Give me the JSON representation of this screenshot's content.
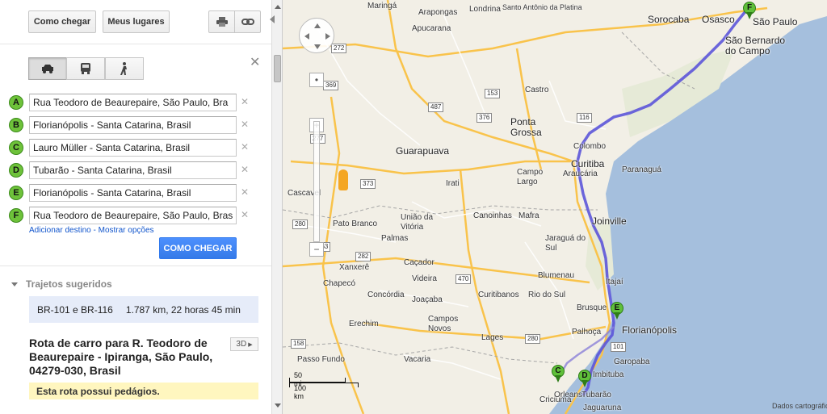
{
  "toolbar": {
    "directions_label": "Como chegar",
    "places_label": "Meus lugares",
    "print_icon": "printer-icon",
    "link_icon": "link-icon"
  },
  "travel_modes": {
    "car_icon": "car-icon",
    "transit_icon": "bus-icon",
    "walk_icon": "walking-icon",
    "selected": "car"
  },
  "waypoints": [
    {
      "letter": "A",
      "value": "Rua Teodoro de Beaurepaire, São Paulo, Bra"
    },
    {
      "letter": "B",
      "value": "Florianópolis - Santa Catarina, Brasil"
    },
    {
      "letter": "C",
      "value": "Lauro Müller - Santa Catarina, Brasil"
    },
    {
      "letter": "D",
      "value": "Tubarão - Santa Catarina, Brasil"
    },
    {
      "letter": "E",
      "value": "Florianópolis - Santa Catarina, Brasil"
    },
    {
      "letter": "F",
      "value": "Rua Teodoro de Beaurepaire, São Paulo, Bras"
    }
  ],
  "links": {
    "add_destination": "Adicionar destino",
    "separator": " - ",
    "show_options": "Mostrar opções"
  },
  "go_button": "COMO CHEGAR",
  "suggested": {
    "heading": "Trajetos sugeridos",
    "route_name": "BR-101 e BR-116",
    "route_summary": "1.787 km, 22 horas 45 min"
  },
  "route_title": "Rota de carro para R. Teodoro de Beaurepaire - Ipiranga, São Paulo, 04279-030, Brasil",
  "btn_3d": "3D",
  "toll_notice": "Esta rota possui pedágios.",
  "map": {
    "cities": [
      {
        "name": "Maringá"
      },
      {
        "name": "Arapongas"
      },
      {
        "name": "Londrina"
      },
      {
        "name": "Apucarana"
      },
      {
        "name": "Santo Antônio da Platina"
      },
      {
        "name": "Sorocaba"
      },
      {
        "name": "Osasco"
      },
      {
        "name": "São Paulo"
      },
      {
        "name": "São Bernardo do Campo"
      },
      {
        "name": "Ponta Grossa"
      },
      {
        "name": "Guarapuava"
      },
      {
        "name": "Colombo"
      },
      {
        "name": "Curitiba"
      },
      {
        "name": "Araucária"
      },
      {
        "name": "Campo Largo"
      },
      {
        "name": "Paranaguá"
      },
      {
        "name": "Joinville"
      },
      {
        "name": "Jaraguá do Sul"
      },
      {
        "name": "Blumenau"
      },
      {
        "name": "Itajaí"
      },
      {
        "name": "Florianópolis"
      },
      {
        "name": "Palhoça"
      },
      {
        "name": "Chapecó"
      },
      {
        "name": "Erechim"
      },
      {
        "name": "Lages"
      },
      {
        "name": "Criciúma"
      },
      {
        "name": "Tubarão"
      },
      {
        "name": "Orleans"
      },
      {
        "name": "Jaguaruna"
      },
      {
        "name": "Garopaba"
      },
      {
        "name": "Imbituba"
      },
      {
        "name": "Cascavel"
      },
      {
        "name": "Pato Branco"
      },
      {
        "name": "Palmas"
      },
      {
        "name": "União da Vitória"
      },
      {
        "name": "Canoinhas"
      },
      {
        "name": "Mafra"
      },
      {
        "name": "Caçador"
      },
      {
        "name": "Videira"
      },
      {
        "name": "Concórdia"
      },
      {
        "name": "Xanxerê"
      },
      {
        "name": "Joaçaba"
      },
      {
        "name": "Campos Novos"
      },
      {
        "name": "Curitibanos"
      },
      {
        "name": "Rio do Sul"
      },
      {
        "name": "Brusque"
      },
      {
        "name": "Passo Fundo"
      },
      {
        "name": "Vacaria"
      },
      {
        "name": "Irati"
      },
      {
        "name": "Castro"
      }
    ],
    "roads": [
      "487",
      "376",
      "277",
      "373",
      "153",
      "116",
      "101",
      "282",
      "470",
      "280",
      "163",
      "158",
      "369",
      "280",
      "272"
    ],
    "scale": {
      "top": "50 mi",
      "bottom": "100 km"
    },
    "attribution": "Dados cartográficos",
    "pins": [
      {
        "letter": "F"
      },
      {
        "letter": "E"
      },
      {
        "letter": "C"
      },
      {
        "letter": "D"
      }
    ],
    "colors": {
      "land": "#f2efe6",
      "water": "#a5bfdd",
      "route": "#5c55d9",
      "highway": "#f9c34b"
    }
  }
}
